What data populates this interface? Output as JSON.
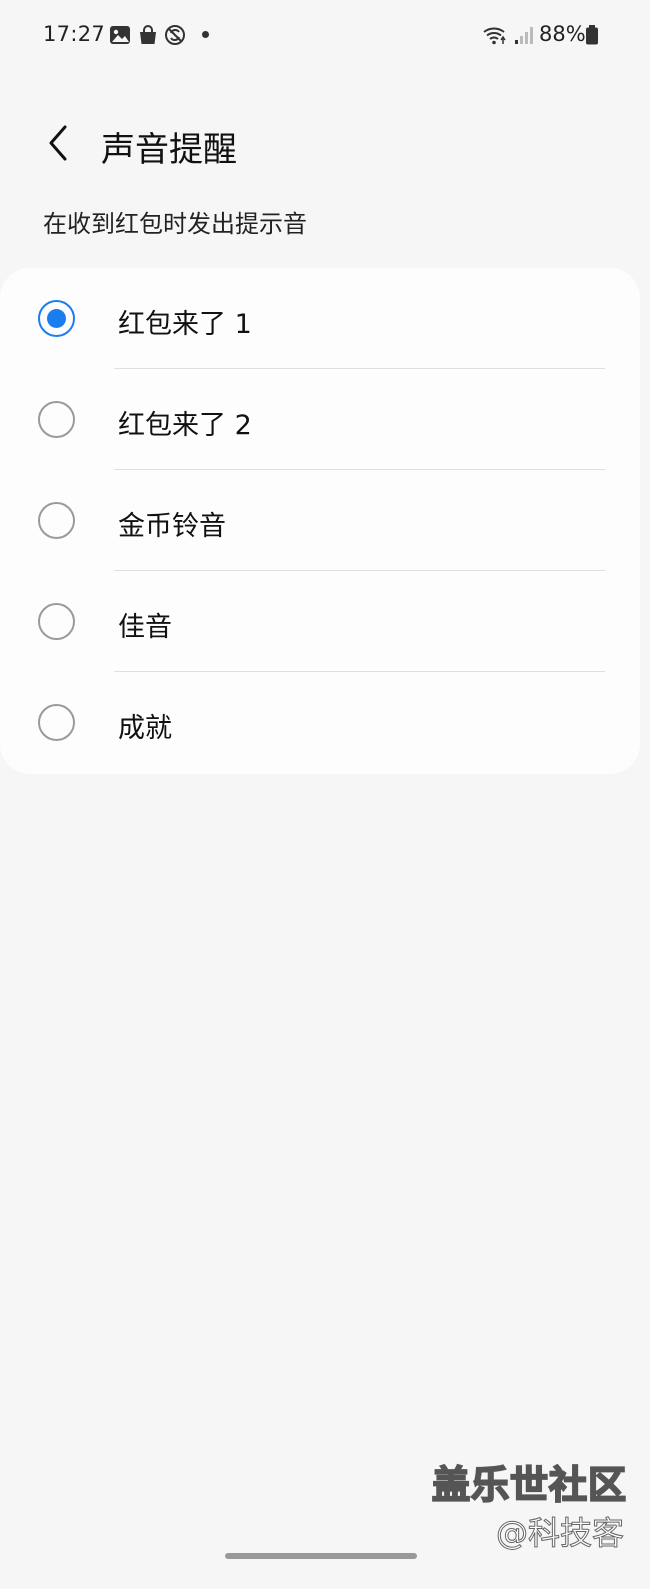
{
  "status_bar": {
    "time": "17:27",
    "battery": "88%",
    "left_icons": [
      "gallery-icon",
      "shopping-bag-icon",
      "no-sync-icon",
      "notification-dot"
    ],
    "right_icons": [
      "wifi-icon",
      "signal-icon",
      "battery-icon"
    ]
  },
  "header": {
    "title": "声音提醒",
    "back_icon": "chevron-left-icon"
  },
  "subtitle": "在收到红包时发出提示音",
  "options": [
    {
      "label": "红包来了 1",
      "selected": true
    },
    {
      "label": "红包来了 2",
      "selected": false
    },
    {
      "label": "金币铃音",
      "selected": false
    },
    {
      "label": "佳音",
      "selected": false
    },
    {
      "label": "成就",
      "selected": false
    }
  ],
  "watermark": {
    "line1": "盖乐世社区",
    "line2": "@科技客"
  },
  "colors": {
    "accent": "#1a7ef0",
    "background": "#f6f6f6",
    "card": "#fdfdfd"
  }
}
